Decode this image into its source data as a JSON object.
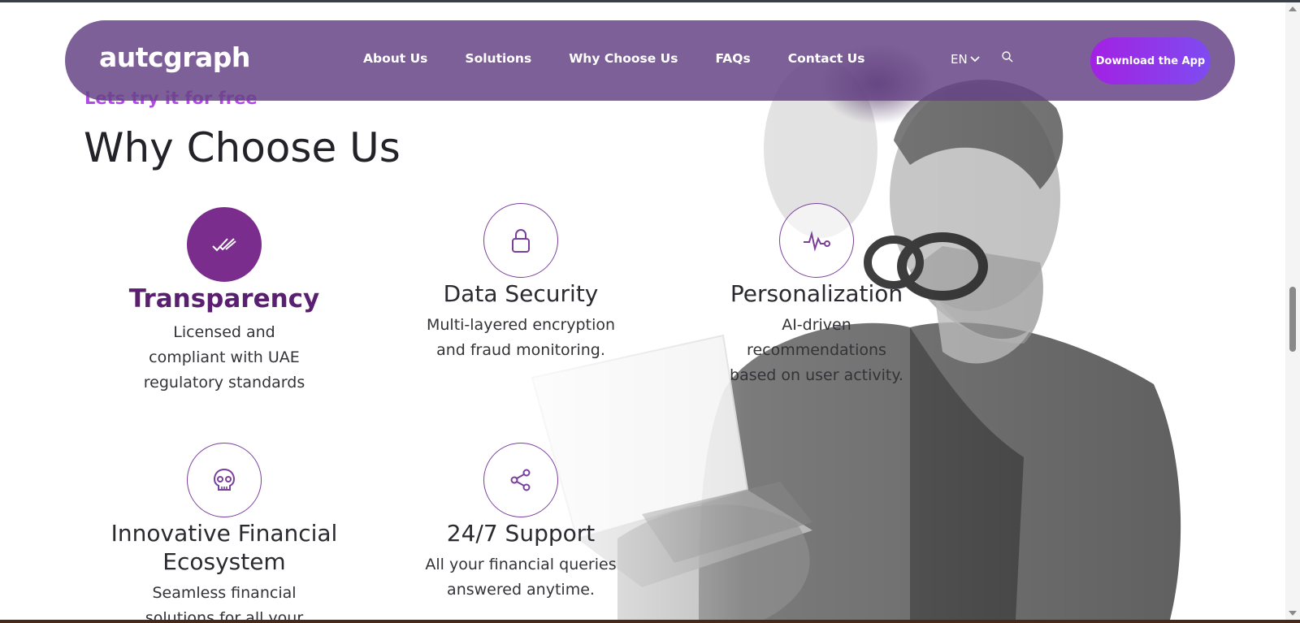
{
  "nav": {
    "logo": "autcgraph",
    "links": [
      "About Us",
      "Solutions",
      "Why Choose Us",
      "FAQs",
      "Contact Us"
    ],
    "language": "EN",
    "download_label": "Download the App"
  },
  "section": {
    "eyebrow": "Lets try it for free",
    "title": "Why Choose Us"
  },
  "features": [
    {
      "title": "Transparency",
      "desc": [
        "Licensed and",
        "compliant with UAE",
        "regulatory standards"
      ],
      "icon": "double-check-icon"
    },
    {
      "title": "Data Security",
      "desc": [
        "Multi-layered encryption",
        "and fraud monitoring."
      ],
      "icon": "lock-icon"
    },
    {
      "title": "Personalization",
      "desc": [
        "AI-driven",
        "recommendations",
        "based on user activity."
      ],
      "icon": "pulse-icon"
    },
    {
      "title": "Innovative Financial Ecosystem",
      "desc": [
        "Seamless financial",
        "solutions for all your"
      ],
      "icon": "skull-icon"
    },
    {
      "title": "24/7 Support",
      "desc": [
        "All your financial queries",
        "answered anytime."
      ],
      "icon": "share-icon"
    }
  ],
  "colors": {
    "navbar": "#664485",
    "accent": "#7b2d8e",
    "button_gradient_start": "#a321e3",
    "button_gradient_end": "#7e4cf0",
    "eyebrow": "#b348e8"
  }
}
